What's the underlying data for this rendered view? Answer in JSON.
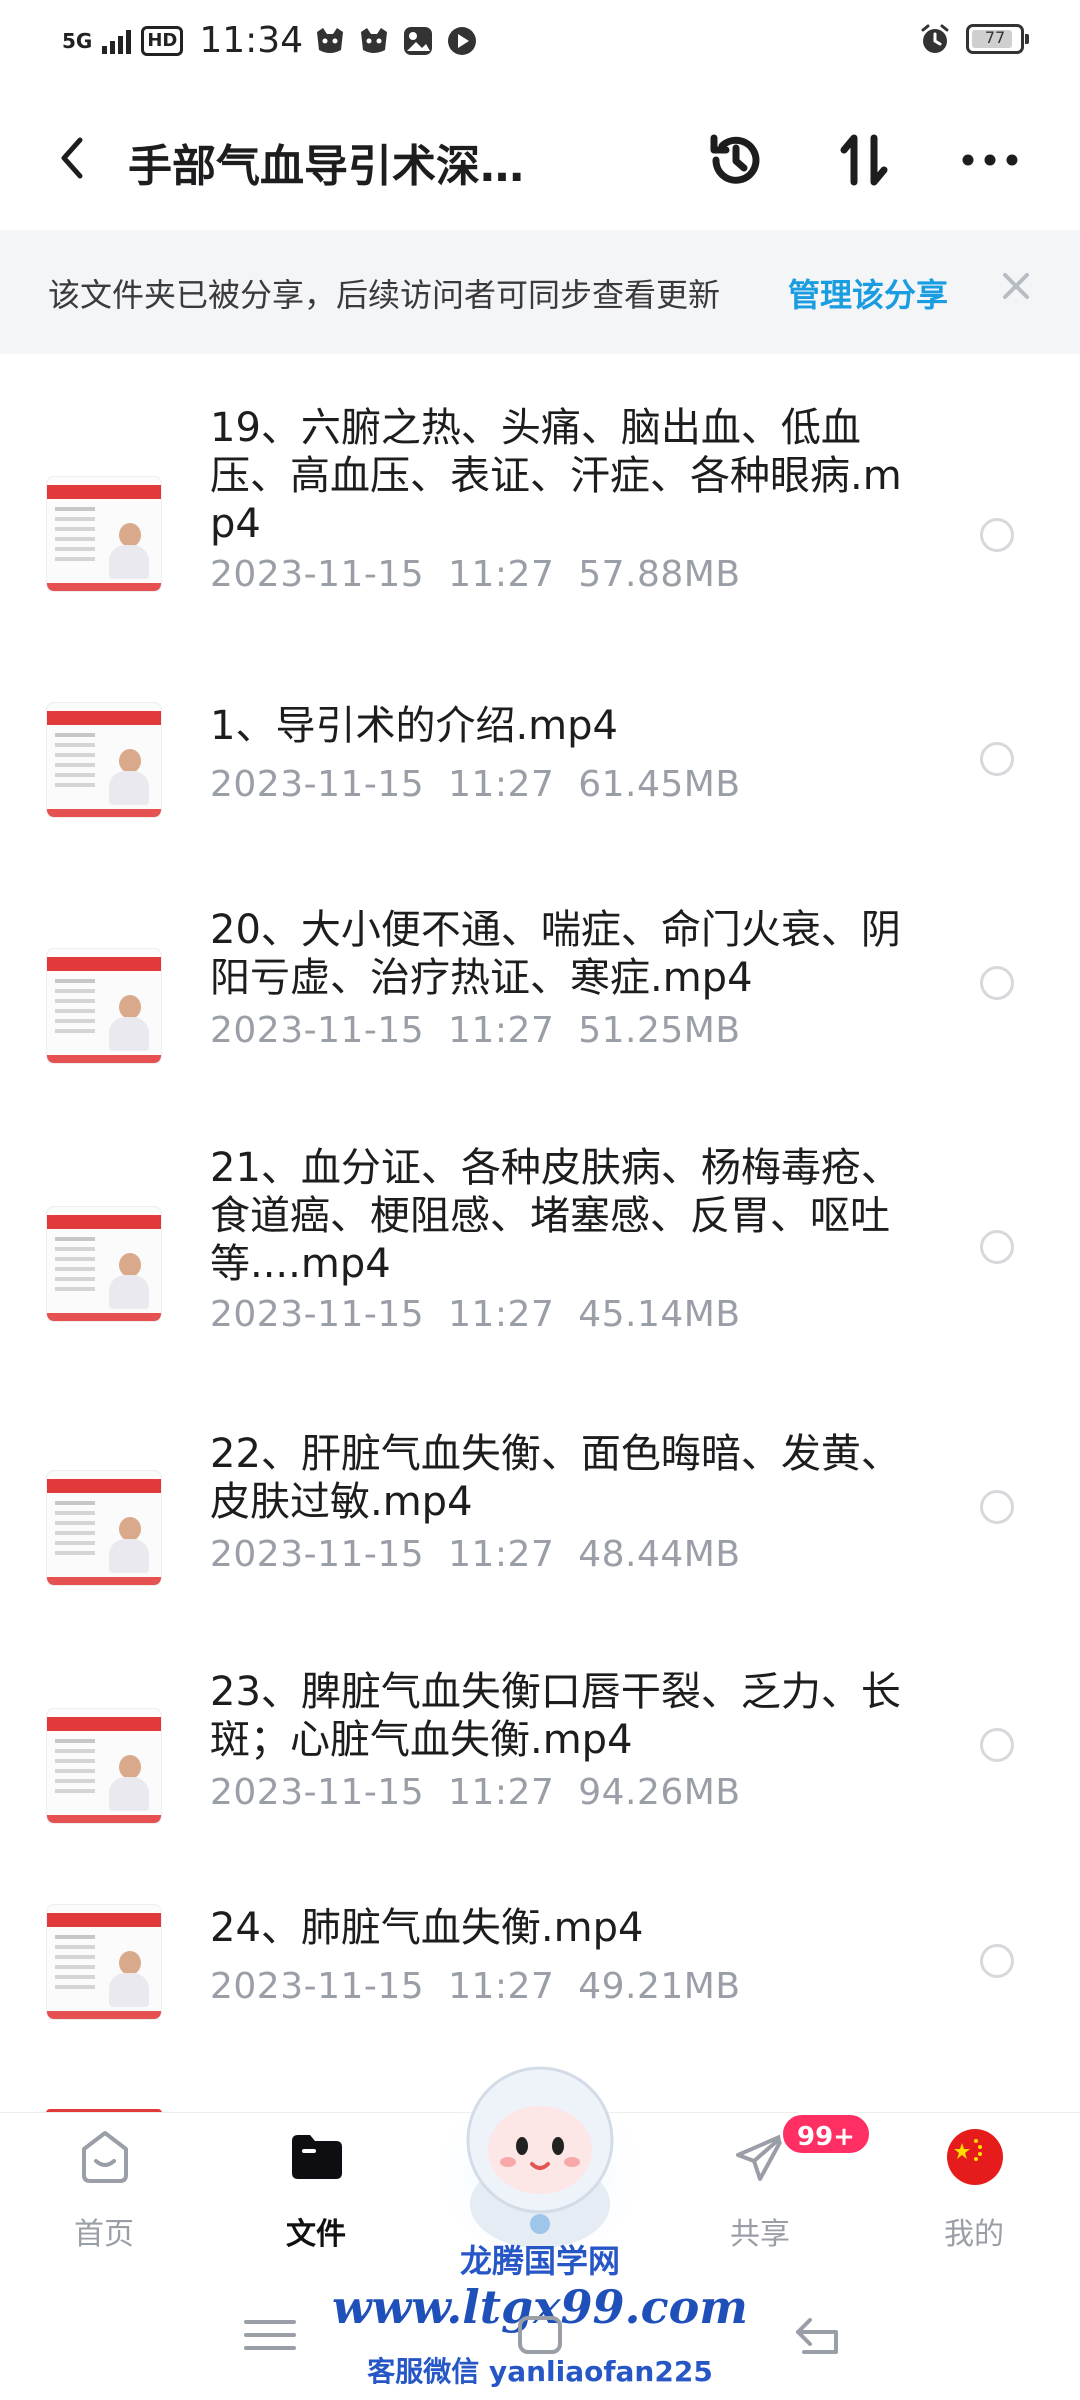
{
  "status_bar": {
    "network": "5G",
    "hd": "HD",
    "time": "11:34",
    "battery": "77",
    "battery_level_pct": 77
  },
  "header": {
    "title": "手部气血导引术深…"
  },
  "share_banner": {
    "text": "该文件夹已被分享，后续访问者可同步查看更新",
    "manage_label": "管理该分享"
  },
  "files": [
    {
      "name": "19、六腑之热、头痛、脑出血、低血压、高血压、表证、汗症、各种眼病.mp4",
      "date": "2023-11-15",
      "time": "11:27",
      "size": "57.88MB"
    },
    {
      "name": "1、导引术的介绍.mp4",
      "date": "2023-11-15",
      "time": "11:27",
      "size": "61.45MB"
    },
    {
      "name": "20、大小便不通、喘症、命门火衰、阴阳亏虚、治疗热证、寒症.mp4",
      "date": "2023-11-15",
      "time": "11:27",
      "size": "51.25MB"
    },
    {
      "name": "21、血分证、各种皮肤病、杨梅毒疮、食道癌、梗阻感、堵塞感、反胃、呕吐等....mp4",
      "date": "2023-11-15",
      "time": "11:27",
      "size": "45.14MB"
    },
    {
      "name": "22、肝脏气血失衡、面色晦暗、发黄、皮肤过敏.mp4",
      "date": "2023-11-15",
      "time": "11:27",
      "size": "48.44MB"
    },
    {
      "name": "23、脾脏气血失衡口唇干裂、乏力、长斑；心脏气血失衡.mp4",
      "date": "2023-11-15",
      "time": "11:27",
      "size": "94.26MB"
    },
    {
      "name": "24、肺脏气血失衡.mp4",
      "date": "2023-11-15",
      "time": "11:27",
      "size": "49.21MB"
    }
  ],
  "tabs": [
    {
      "label": "首页",
      "icon": "home-icon",
      "active": false
    },
    {
      "label": "文件",
      "icon": "folder-icon",
      "active": true
    },
    {
      "label": "共享",
      "icon": "paper-plane-icon",
      "active": false
    },
    {
      "label": "我的",
      "icon": "china-flag-icon",
      "active": false
    }
  ],
  "share_badge": "99+",
  "watermark": {
    "title": "龙腾国学网",
    "url": "www.ltgx99.com",
    "contact": "客服微信 yanliaofan225"
  },
  "colors": {
    "accent": "#1a9de0",
    "badge": "#ff2e63",
    "meta_text": "#9a9ea6",
    "banner_bg": "#f4f5f7"
  }
}
